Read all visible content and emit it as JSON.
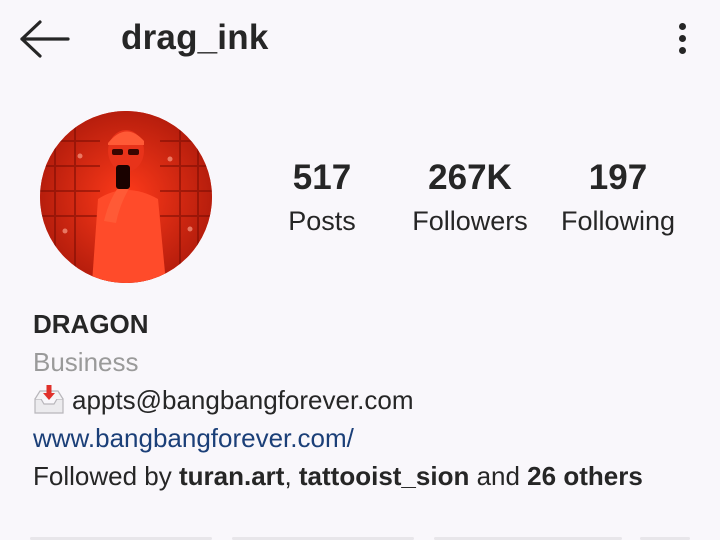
{
  "header": {
    "username": "drag_ink",
    "back_icon": "arrow-left-icon",
    "more_icon": "more-vertical-icon"
  },
  "profile": {
    "avatar_description_icon": "profile-avatar",
    "stats": {
      "posts": {
        "value": "517",
        "label": "Posts"
      },
      "followers": {
        "value": "267K",
        "label": "Followers"
      },
      "following": {
        "value": "197",
        "label": "Following"
      }
    }
  },
  "bio": {
    "display_name": "DRAGON",
    "category": "Business",
    "email_icon": "inbox-tray-icon",
    "email": "appts@bangbangforever.com",
    "website": "www.bangbangforever.com/",
    "followed_by": {
      "prefix": "Followed by ",
      "user1": "turan.art",
      "separator": ", ",
      "user2": "tattooist_sion",
      "middle": " and ",
      "others": "26 others"
    }
  },
  "colors": {
    "background": "#f9f7fb",
    "text": "#262626",
    "muted": "#9a9a9a",
    "link": "#1b3f78",
    "avatar_red": "#d82410"
  }
}
